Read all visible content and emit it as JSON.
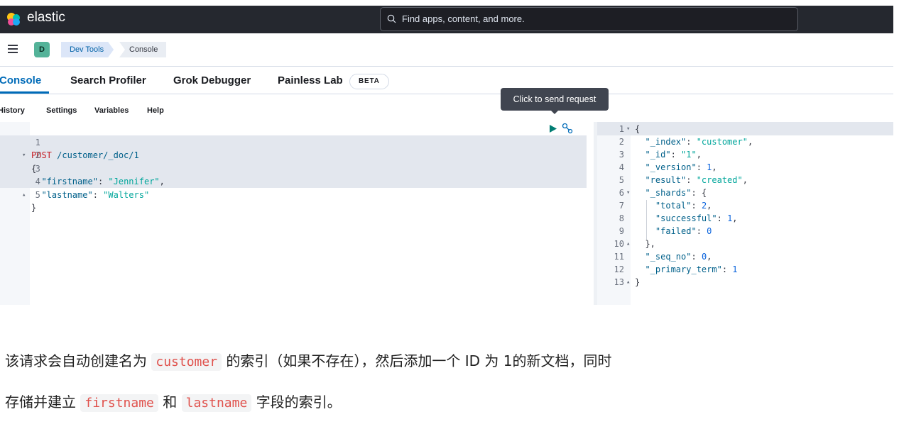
{
  "header": {
    "brand": "elastic",
    "search_placeholder": "Find apps, content, and more."
  },
  "breadcrumbs": {
    "space_badge": "D",
    "items": [
      "Dev Tools",
      "Console"
    ]
  },
  "tabs": [
    {
      "label": "Console",
      "active": true
    },
    {
      "label": "Search Profiler"
    },
    {
      "label": "Grok Debugger"
    },
    {
      "label": "Painless Lab"
    }
  ],
  "beta_badge": "BETA",
  "tooltip": "Click to send request",
  "console_menu": [
    "History",
    "Settings",
    "Variables",
    "Help"
  ],
  "request": {
    "method": "POST",
    "path": "/customer/_doc/1",
    "body": {
      "firstname": "Jennifer",
      "lastname": "Walters"
    }
  },
  "request_lines": {
    "l3_key": "\"firstname\"",
    "l3_val": "\"Jennifer\"",
    "l4_key": "\"lastname\"",
    "l4_val": "\"Walters\""
  },
  "response_lines": {
    "index_key": "\"_index\"",
    "index_val": "\"customer\"",
    "id_key": "\"_id\"",
    "id_val": "\"1\"",
    "version_key": "\"_version\"",
    "version_val": "1",
    "result_key": "\"result\"",
    "result_val": "\"created\"",
    "shards_key": "\"_shards\"",
    "total_key": "\"total\"",
    "total_val": "2",
    "successful_key": "\"successful\"",
    "successful_val": "1",
    "failed_key": "\"failed\"",
    "failed_val": "0",
    "seq_key": "\"_seq_no\"",
    "seq_val": "0",
    "term_key": "\"_primary_term\"",
    "term_val": "1"
  },
  "article": {
    "line1_a": "该请求会自动创建名为",
    "line1_code": "customer",
    "line1_b": "的索引（如果不存在），然后添加一个 ID 为 1的新文档，同时",
    "line2_a": "存储并建立",
    "line2_code1": "firstname",
    "line2_b": "和",
    "line2_code2": "lastname",
    "line2_c": "字段的索引。"
  },
  "colors": {
    "topbar": "#25282f",
    "accent": "#006bb8",
    "space_badge": "#54b399",
    "code_string": "#00a69b",
    "code_method": "#c61e25",
    "inline_code": "#e0524d"
  },
  "icons": [
    "elastic-logo-icon",
    "search-icon",
    "hamburger-menu-icon",
    "play-icon",
    "wrench-icon"
  ]
}
